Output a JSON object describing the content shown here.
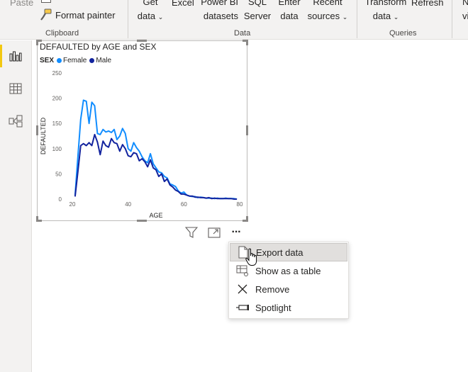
{
  "ribbon": {
    "paste_label": "Paste",
    "format_painter_label": "Format painter",
    "clipboard_group": "Clipboard",
    "data_group": "Data",
    "queries_group": "Queries",
    "get_data": [
      "Get",
      "data"
    ],
    "excel": "Excel",
    "power_bi_datasets": [
      "Power BI",
      "datasets"
    ],
    "sql_server": [
      "SQL",
      "Server"
    ],
    "enter_data": [
      "Enter",
      "data"
    ],
    "recent_sources": [
      "Recent",
      "sources"
    ],
    "transform_data": [
      "Transform",
      "data"
    ],
    "refresh": "Refresh",
    "partial_right": [
      "N",
      "vi"
    ]
  },
  "leftnav": {
    "items": [
      {
        "name": "report-view",
        "icon": "bar-chart-icon",
        "active": true
      },
      {
        "name": "data-view",
        "icon": "table-grid-icon",
        "active": false
      },
      {
        "name": "model-view",
        "icon": "model-icon",
        "active": false
      }
    ]
  },
  "visual": {
    "title": "DEFAULTED by AGE and SEX",
    "legend_title": "SEX",
    "legend_items": [
      {
        "label": "Female",
        "color": "#118dff"
      },
      {
        "label": "Male",
        "color": "#12239e"
      }
    ]
  },
  "chart_data": {
    "type": "line",
    "title": "DEFAULTED by AGE and SEX",
    "xlabel": "AGE",
    "ylabel": "DEFAULTED",
    "xlim": [
      20,
      80
    ],
    "ylim": [
      0,
      250
    ],
    "x_ticks": [
      20,
      40,
      60,
      80
    ],
    "y_ticks": [
      0,
      50,
      100,
      150,
      200,
      250
    ],
    "grid": false,
    "legend_position": "top-left",
    "series": [
      {
        "name": "Female",
        "color": "#118dff",
        "x": [
          21,
          22,
          23,
          24,
          25,
          26,
          27,
          28,
          29,
          30,
          31,
          32,
          33,
          34,
          35,
          36,
          37,
          38,
          39,
          40,
          41,
          42,
          43,
          44,
          45,
          46,
          47,
          48,
          49,
          50,
          51,
          52,
          53,
          54,
          55,
          56,
          57,
          58,
          59,
          60,
          61,
          62,
          63,
          64,
          65,
          66,
          67,
          68,
          69,
          70,
          71,
          72,
          73,
          74,
          75,
          76,
          77,
          78,
          79
        ],
        "values": [
          8,
          85,
          158,
          196,
          194,
          150,
          192,
          185,
          130,
          128,
          138,
          133,
          135,
          132,
          138,
          118,
          125,
          140,
          130,
          100,
          95,
          112,
          102,
          95,
          84,
          76,
          72,
          90,
          70,
          62,
          54,
          52,
          45,
          42,
          30,
          28,
          25,
          16,
          12,
          14,
          8,
          6,
          5,
          5,
          3,
          4,
          3,
          2,
          2,
          2,
          1,
          2,
          1,
          1,
          2,
          1,
          1,
          1,
          0
        ]
      },
      {
        "name": "Male",
        "color": "#12239e",
        "x": [
          21,
          22,
          23,
          24,
          25,
          26,
          27,
          28,
          29,
          30,
          31,
          32,
          33,
          34,
          35,
          36,
          37,
          38,
          39,
          40,
          41,
          42,
          43,
          44,
          45,
          46,
          47,
          48,
          49,
          50,
          51,
          52,
          53,
          54,
          55,
          56,
          57,
          58,
          59,
          60,
          61,
          62,
          63,
          64,
          65,
          66,
          67,
          68,
          69,
          70,
          71,
          72,
          73,
          74,
          75,
          76,
          77,
          78,
          79
        ],
        "values": [
          5,
          55,
          106,
          110,
          106,
          112,
          106,
          128,
          113,
          88,
          115,
          106,
          103,
          120,
          112,
          110,
          95,
          108,
          100,
          86,
          84,
          92,
          90,
          76,
          80,
          74,
          64,
          78,
          62,
          58,
          45,
          50,
          35,
          40,
          28,
          24,
          18,
          15,
          10,
          10,
          8,
          6,
          6,
          4,
          4,
          3,
          3,
          2,
          3,
          1,
          2,
          1,
          1,
          1,
          1,
          1,
          1,
          0,
          0
        ]
      }
    ]
  },
  "visual_header": {
    "filter_icon": "filter-icon",
    "focus_icon": "focus-mode-icon",
    "more_icon": "more-options-icon",
    "more_glyph": "···"
  },
  "context_menu": {
    "items": [
      {
        "label": "Export data",
        "icon": "export-data-icon",
        "hovered": true
      },
      {
        "label": "Show as a table",
        "icon": "show-as-table-icon",
        "hovered": false
      },
      {
        "label": "Remove",
        "icon": "remove-icon",
        "hovered": false
      },
      {
        "label": "Spotlight",
        "icon": "spotlight-icon",
        "hovered": false
      }
    ]
  }
}
